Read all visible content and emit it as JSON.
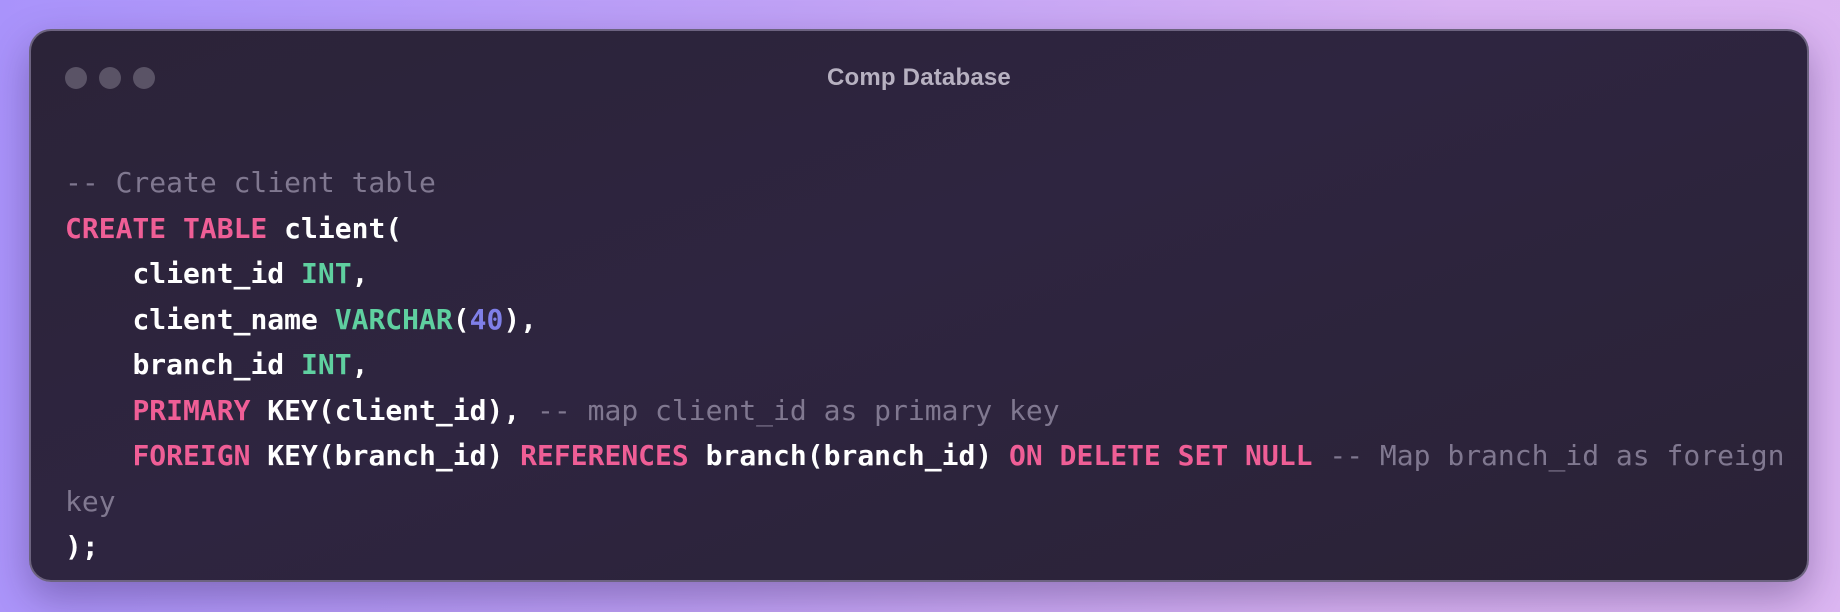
{
  "window": {
    "title": "Comp Database"
  },
  "code_lines": [
    [
      {
        "t": "-- Create client table",
        "c": "cm"
      }
    ],
    [
      {
        "t": "CREATE TABLE",
        "c": "kw"
      },
      {
        "t": " client(",
        "c": "pl"
      }
    ],
    [
      {
        "t": "    client_id ",
        "c": "pl"
      },
      {
        "t": "INT",
        "c": "ty"
      },
      {
        "t": ",",
        "c": "pl"
      }
    ],
    [
      {
        "t": "    client_name ",
        "c": "pl"
      },
      {
        "t": "VARCHAR",
        "c": "ty"
      },
      {
        "t": "(",
        "c": "pl"
      },
      {
        "t": "40",
        "c": "nm"
      },
      {
        "t": "),",
        "c": "pl"
      }
    ],
    [
      {
        "t": "    branch_id ",
        "c": "pl"
      },
      {
        "t": "INT",
        "c": "ty"
      },
      {
        "t": ",",
        "c": "pl"
      }
    ],
    [
      {
        "t": "    ",
        "c": "pl"
      },
      {
        "t": "PRIMARY",
        "c": "kw"
      },
      {
        "t": " KEY(client_id), ",
        "c": "pl"
      },
      {
        "t": "-- map client_id as primary key",
        "c": "cm"
      }
    ],
    [
      {
        "t": "    ",
        "c": "pl"
      },
      {
        "t": "FOREIGN",
        "c": "kw"
      },
      {
        "t": " KEY(branch_id) ",
        "c": "pl"
      },
      {
        "t": "REFERENCES",
        "c": "kw"
      },
      {
        "t": " branch(branch_id) ",
        "c": "pl"
      },
      {
        "t": "ON DELETE SET NULL",
        "c": "kw"
      },
      {
        "t": " ",
        "c": "pl"
      },
      {
        "t": "-- Map branch_id as foreign key",
        "c": "cm"
      }
    ],
    [
      {
        "t": ");",
        "c": "pl"
      }
    ]
  ],
  "colors": {
    "keyword": "#ef5e96",
    "type": "#5fd0a0",
    "number": "#7f7fe8",
    "comment": "#807890",
    "plain": "#ffffff",
    "window_bg": "#2c2439"
  },
  "icons": [
    "close-dot-icon",
    "minimize-dot-icon",
    "zoom-dot-icon"
  ]
}
